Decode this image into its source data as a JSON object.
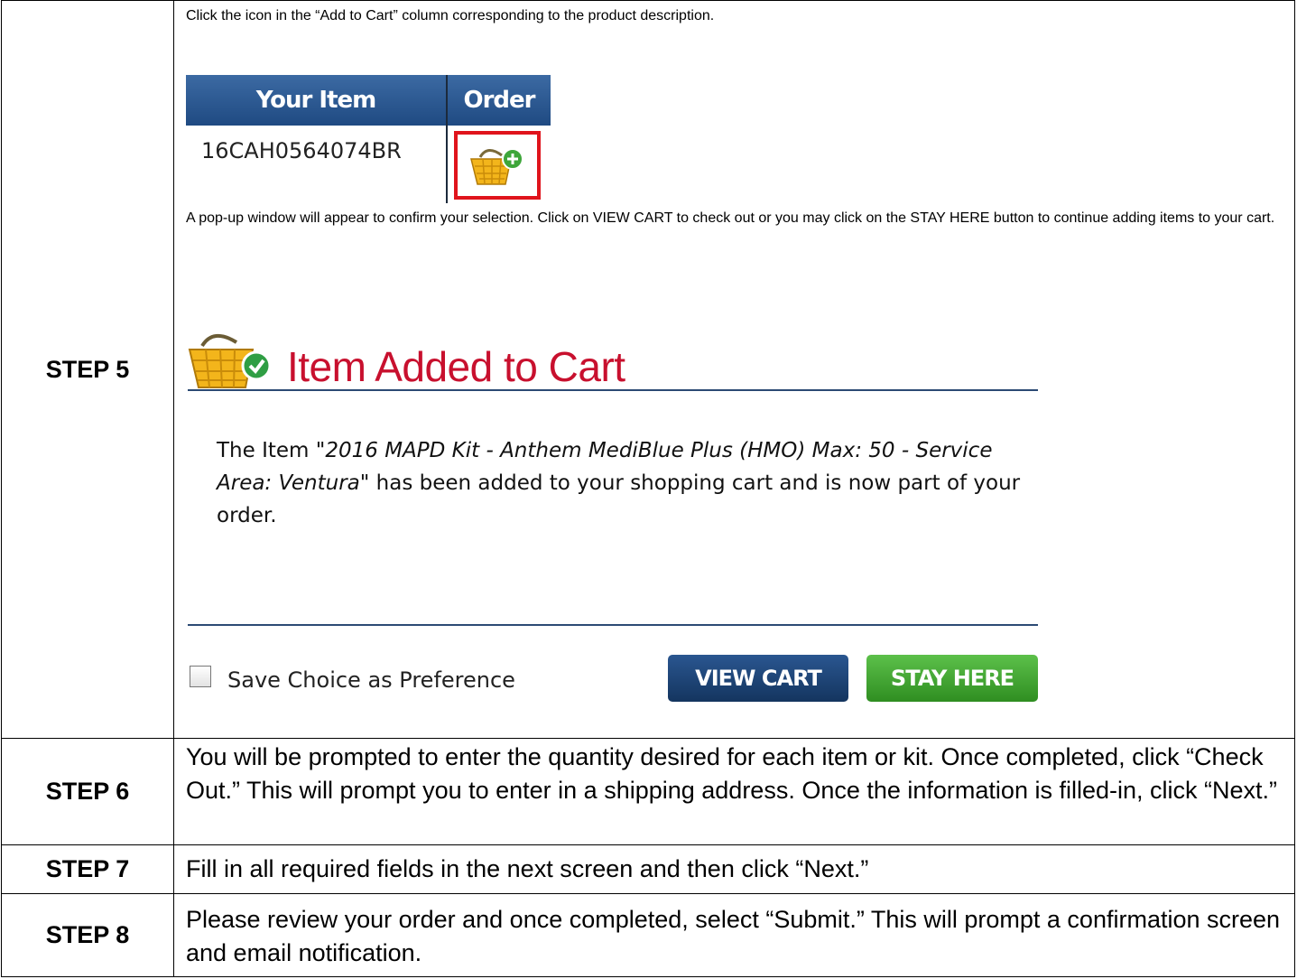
{
  "steps": [
    {
      "label": "STEP 5",
      "para1": "Click the icon in the “Add to Cart” column corresponding to the product description.",
      "mini_table": {
        "col1": "Your Item",
        "col2": "Order",
        "item_code": "16CAH0564074BR",
        "order_icon": "add-to-cart-basket-icon"
      },
      "para2": "A pop-up window will appear to confirm your selection. Click on VIEW CART to check out or you may click on the STAY HERE button to continue adding items to your cart.",
      "popup": {
        "title": "Item Added to Cart",
        "msg_prefix": "The Item ",
        "msg_item": "\"2016 MAPD Kit - Anthem MediBlue Plus (HMO) Max: 50 - Service Area: Ventura\"",
        "msg_suffix": " has been added to your shopping cart and is now part of your order.",
        "checkbox_label": "Save Choice as Preference",
        "checkbox_checked": false,
        "view_cart_label": "VIEW CART",
        "stay_here_label": "STAY HERE",
        "colors": {
          "title": "#c8102e",
          "view_cart": "#1f4678",
          "stay_here": "#45a935"
        }
      }
    },
    {
      "label": "STEP 6",
      "text": "You will be prompted to enter the quantity desired for each item or kit. Once completed, click “Check Out.” This will prompt you to enter in a shipping address. Once the information is filled-in, click “Next.”"
    },
    {
      "label": "STEP 7",
      "text": "Fill in all required fields in the next screen and then click “Next.”"
    },
    {
      "label": "STEP 8",
      "text": "Please review your order and once completed, select “Submit.”  This will prompt a confirmation screen and email notification."
    }
  ]
}
